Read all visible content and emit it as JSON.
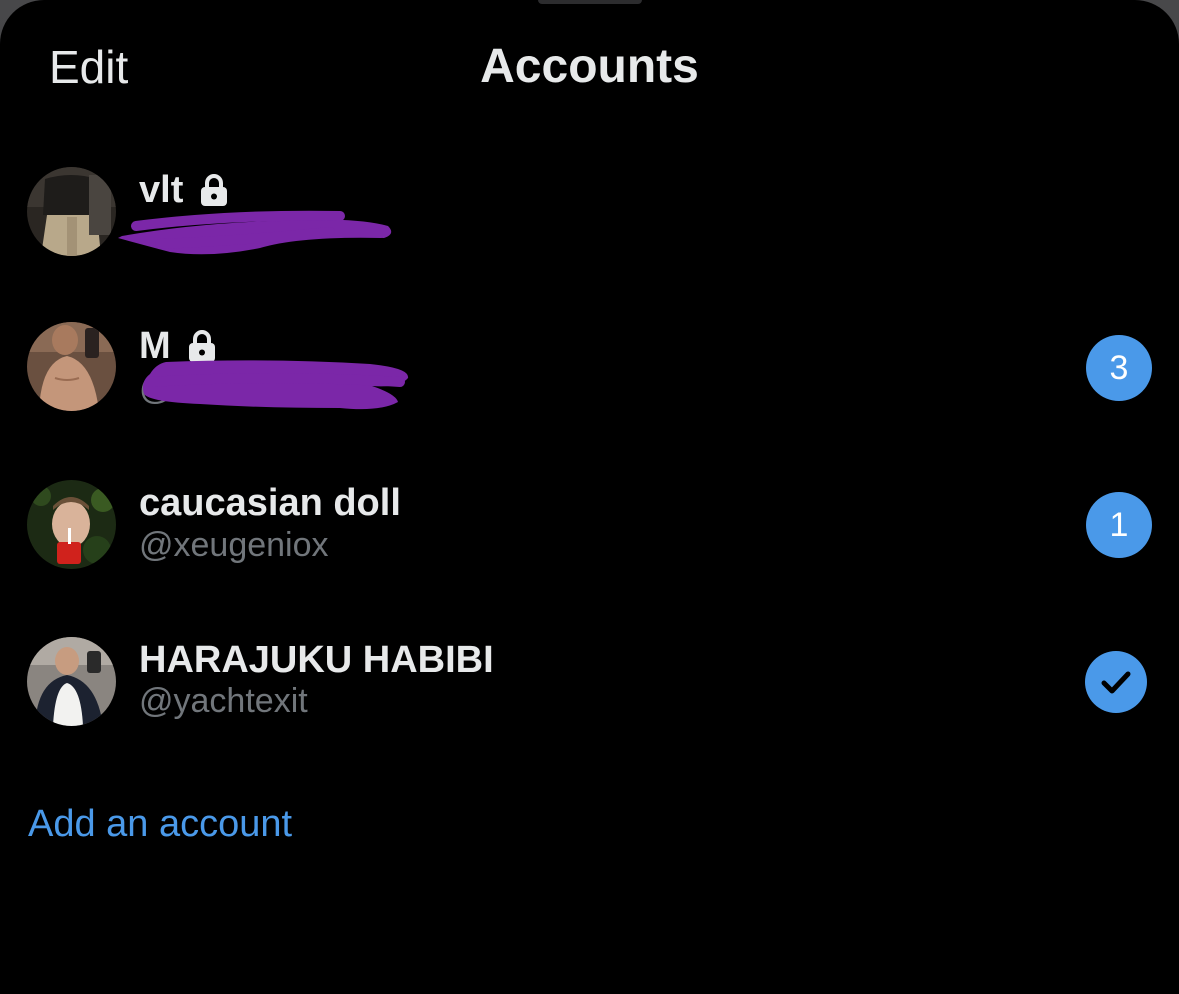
{
  "header": {
    "edit_label": "Edit",
    "title": "Accounts"
  },
  "accounts": [
    {
      "display_name": "vlt",
      "handle": "",
      "protected": true,
      "handle_redacted": true,
      "unread_count": null,
      "active": false
    },
    {
      "display_name": "M",
      "handle": "@",
      "protected": true,
      "handle_redacted": true,
      "unread_count": "3",
      "active": false
    },
    {
      "display_name": "caucasian doll",
      "handle": "@xeugeniox",
      "protected": false,
      "handle_redacted": false,
      "unread_count": "1",
      "active": false
    },
    {
      "display_name": "HARAJUKU HABIBI",
      "handle": "@yachtexit",
      "protected": false,
      "handle_redacted": false,
      "unread_count": null,
      "active": true
    }
  ],
  "footer": {
    "add_account_label": "Add an account"
  },
  "icons": {
    "lock": "lock-icon",
    "check": "checkmark-icon"
  },
  "colors": {
    "background": "#000000",
    "text_primary": "#e7e9ea",
    "text_secondary": "#71767b",
    "accent": "#4a99e9",
    "redaction": "#7b27a8"
  }
}
